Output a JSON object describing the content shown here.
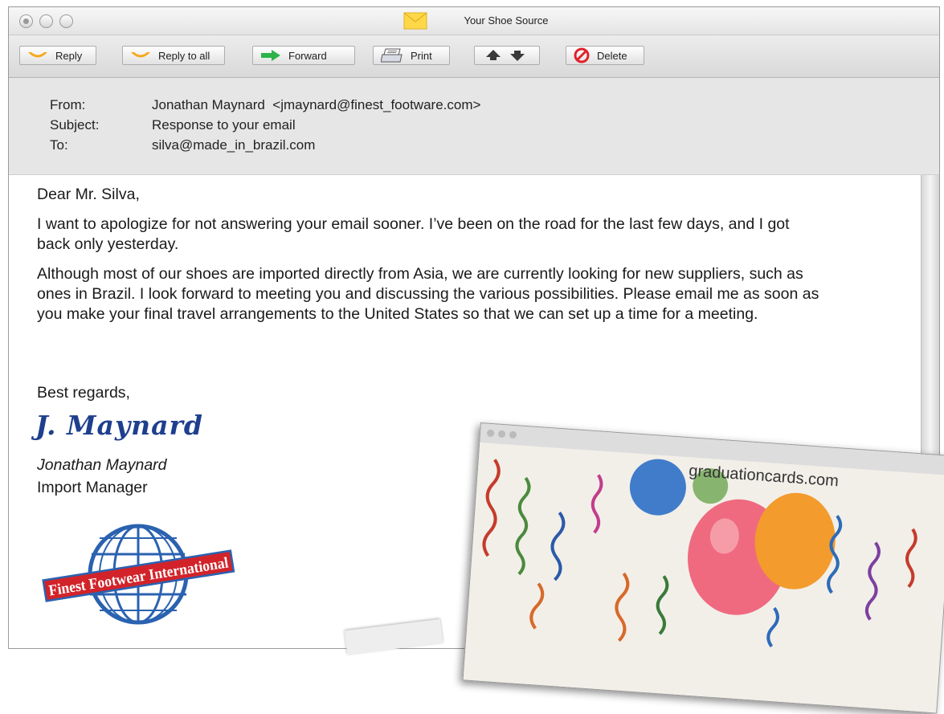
{
  "window": {
    "title": "Your Shoe Source"
  },
  "toolbar": {
    "reply": "Reply",
    "reply_all": "Reply to all",
    "forward": "Forward",
    "print": "Print",
    "delete": "Delete"
  },
  "header": {
    "from_label": "From:",
    "from_value": "Jonathan Maynard  <jmaynard@finest_footware.com>",
    "subject_label": "Subject:",
    "subject_value": "Response to your email",
    "to_label": "To:",
    "to_value": "silva@made_in_brazil.com"
  },
  "message": {
    "greeting": "Dear Mr. Silva,",
    "paragraphs": [
      "I want to apologize for not answering your email sooner. I’ve been on the road for the last few days, and I got back only yesterday.",
      "Although most of our shoes are imported directly from Asia, we are currently looking for new suppliers, such as ones in Brazil. I look forward to meeting you and discussing the various possibilities. Please email me as soon as you make your final travel arrangements to the United States so that we can set up a time for a meeting."
    ],
    "closing": "Best regards,",
    "signature": "J. Maynard",
    "sender_name": "Jonathan Maynard",
    "sender_title": "Import Manager"
  },
  "logo": {
    "text": "Finest Footwear International"
  },
  "overlay_card": {
    "url": "graduationcards.com"
  },
  "colors": {
    "signature": "#1e3f8e",
    "logo_red": "#d2232a",
    "logo_blue": "#2a62b0"
  }
}
